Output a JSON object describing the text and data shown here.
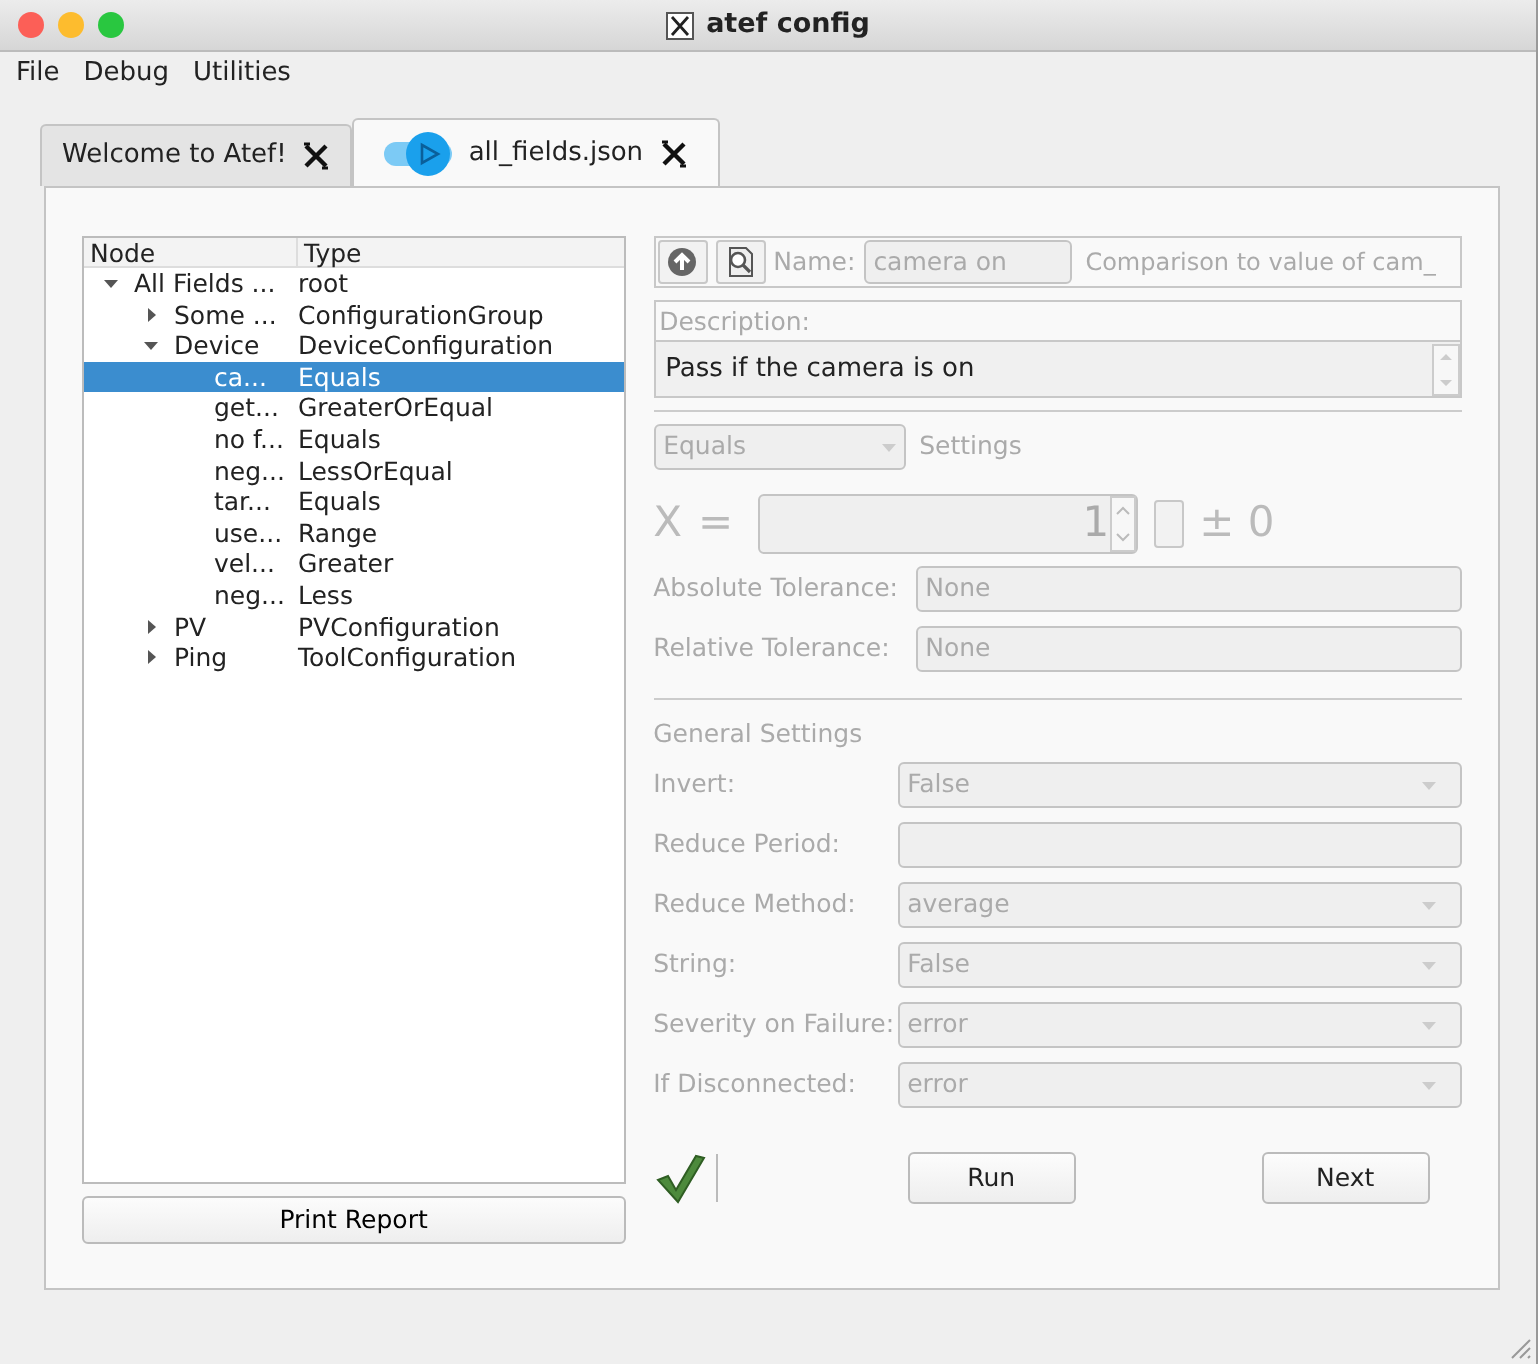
{
  "window": {
    "title": "atef config"
  },
  "menu": [
    "File",
    "Debug",
    "Utilities"
  ],
  "tabs": [
    {
      "label": "Welcome to Atef!",
      "selected": false
    },
    {
      "label": "all_fields.json",
      "selected": true,
      "toggle_on": true
    }
  ],
  "tree": {
    "columns": [
      "Node",
      "Type"
    ],
    "rows": [
      {
        "node": "All Fields ...",
        "type": "root",
        "expanded": true,
        "selected": false,
        "children": [
          {
            "node": "Some ...",
            "type": "ConfigurationGroup",
            "expanded": false,
            "selected": false
          },
          {
            "node": "Device",
            "type": "DeviceConfiguration",
            "expanded": true,
            "selected": false,
            "children": [
              {
                "node": "ca...",
                "type": "Equals",
                "selected": true
              },
              {
                "node": "get...",
                "type": "GreaterOrEqual",
                "selected": false
              },
              {
                "node": "no f...",
                "type": "Equals",
                "selected": false
              },
              {
                "node": "neg...",
                "type": "LessOrEqual",
                "selected": false
              },
              {
                "node": "tar...",
                "type": "Equals",
                "selected": false
              },
              {
                "node": "use...",
                "type": "Range",
                "selected": false
              },
              {
                "node": "vel...",
                "type": "Greater",
                "selected": false
              },
              {
                "node": "neg...",
                "type": "Less",
                "selected": false
              }
            ]
          },
          {
            "node": "PV",
            "type": "PVConfiguration",
            "expanded": false,
            "selected": false
          },
          {
            "node": "Ping",
            "type": "ToolConfiguration",
            "expanded": false,
            "selected": false
          }
        ]
      }
    ]
  },
  "print_button": "Print Report",
  "editor": {
    "disabled": true,
    "name_label": "Name:",
    "name": "camera on",
    "name_desc": "Comparison to value of cam_",
    "description_label": "Description:",
    "description": "Pass if the camera is on",
    "comparison": "Equals",
    "settings_label": "Settings",
    "x_label": "X",
    "equals": "=",
    "value": "1",
    "plus_minus": "± 0",
    "tolerances": [
      {
        "label": "Absolute Tolerance:",
        "value": "None"
      },
      {
        "label": "Relative Tolerance:",
        "value": "None"
      }
    ],
    "general_title": "General Settings",
    "general": [
      {
        "label": "Invert:",
        "kind": "dropdown",
        "value": "False"
      },
      {
        "label": "Reduce Period:",
        "kind": "text"
      },
      {
        "label": "Reduce Method:",
        "kind": "dropdown",
        "value": "average"
      },
      {
        "label": "String:",
        "kind": "dropdown",
        "value": "False"
      },
      {
        "label": "Severity on Failure:",
        "kind": "dropdown",
        "value": "error"
      },
      {
        "label": "If Disconnected:",
        "kind": "dropdown",
        "value": "error"
      }
    ],
    "passed": true,
    "buttons": [
      "Run",
      "Next"
    ]
  }
}
